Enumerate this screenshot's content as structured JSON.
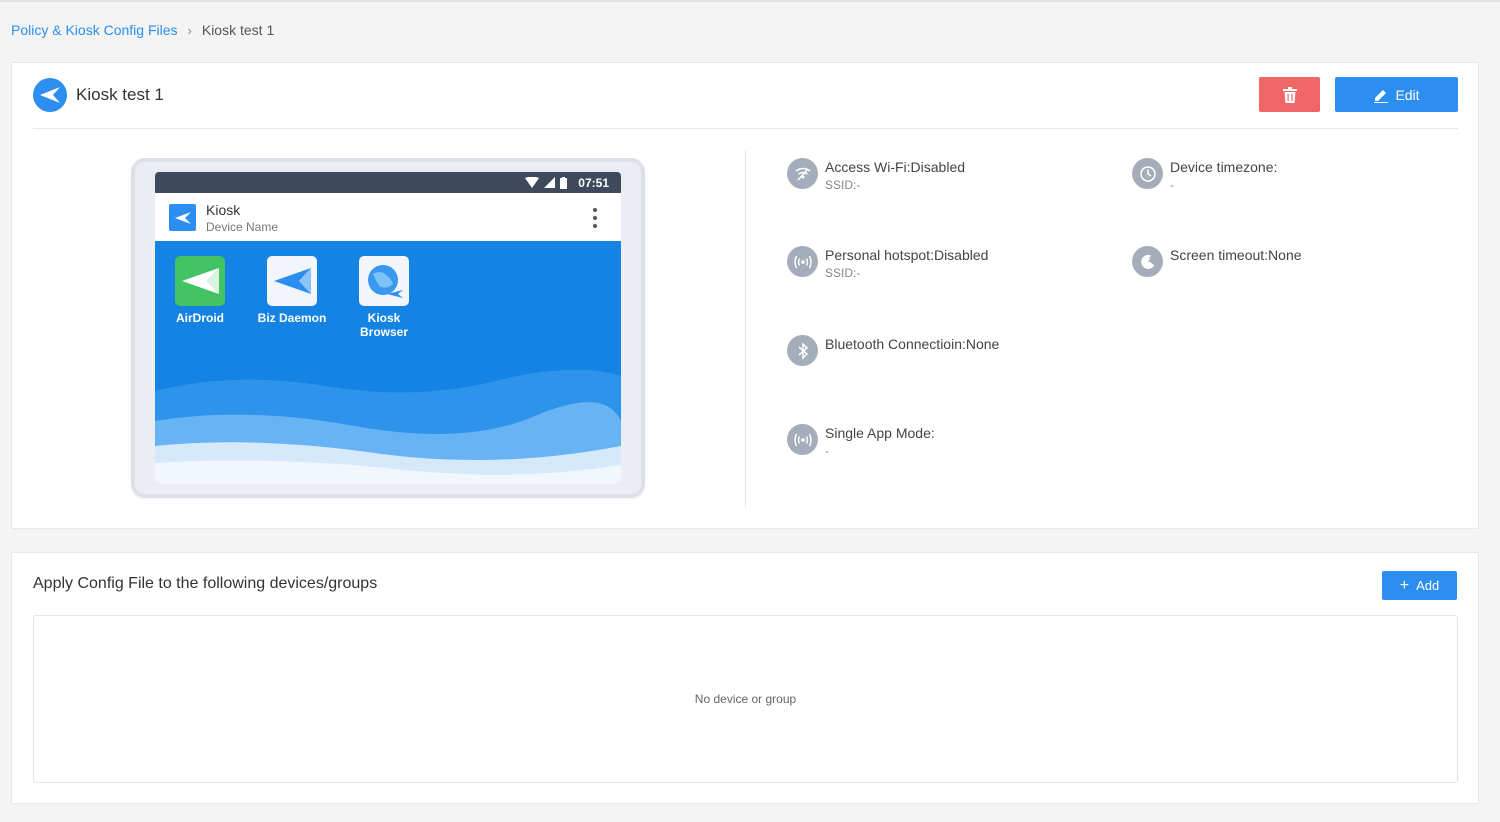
{
  "breadcrumb": {
    "parent": "Policy & Kiosk Config Files",
    "current": "Kiosk test 1"
  },
  "header": {
    "title": "Kiosk test 1",
    "edit_label": "Edit"
  },
  "device_preview": {
    "time": "07:51",
    "app_title": "Kiosk",
    "app_subtitle": "Device Name",
    "apps": [
      {
        "label": "AirDroid"
      },
      {
        "label": "Biz Daemon"
      },
      {
        "label": "Kiosk\nBrowser"
      }
    ]
  },
  "settings": {
    "wifi": {
      "label": "Access Wi-Fi:Disabled",
      "sub": "SSID:-"
    },
    "hotspot": {
      "label": "Personal hotspot:Disabled",
      "sub": "SSID:-"
    },
    "bluetooth": {
      "label": "Bluetooth Connectioin:None"
    },
    "single_app": {
      "label": "Single App Mode:",
      "sub": "-"
    },
    "timezone": {
      "label": "Device timezone:",
      "sub": "-"
    },
    "screen_timeout": {
      "label": "Screen timeout:None"
    }
  },
  "apply_section": {
    "title": "Apply Config File to the following devices/groups",
    "add_label": "Add",
    "empty_text": "No device or group"
  },
  "colors": {
    "accent": "#2b8ef0",
    "danger": "#f06565",
    "icon_gray": "#a5adba"
  }
}
